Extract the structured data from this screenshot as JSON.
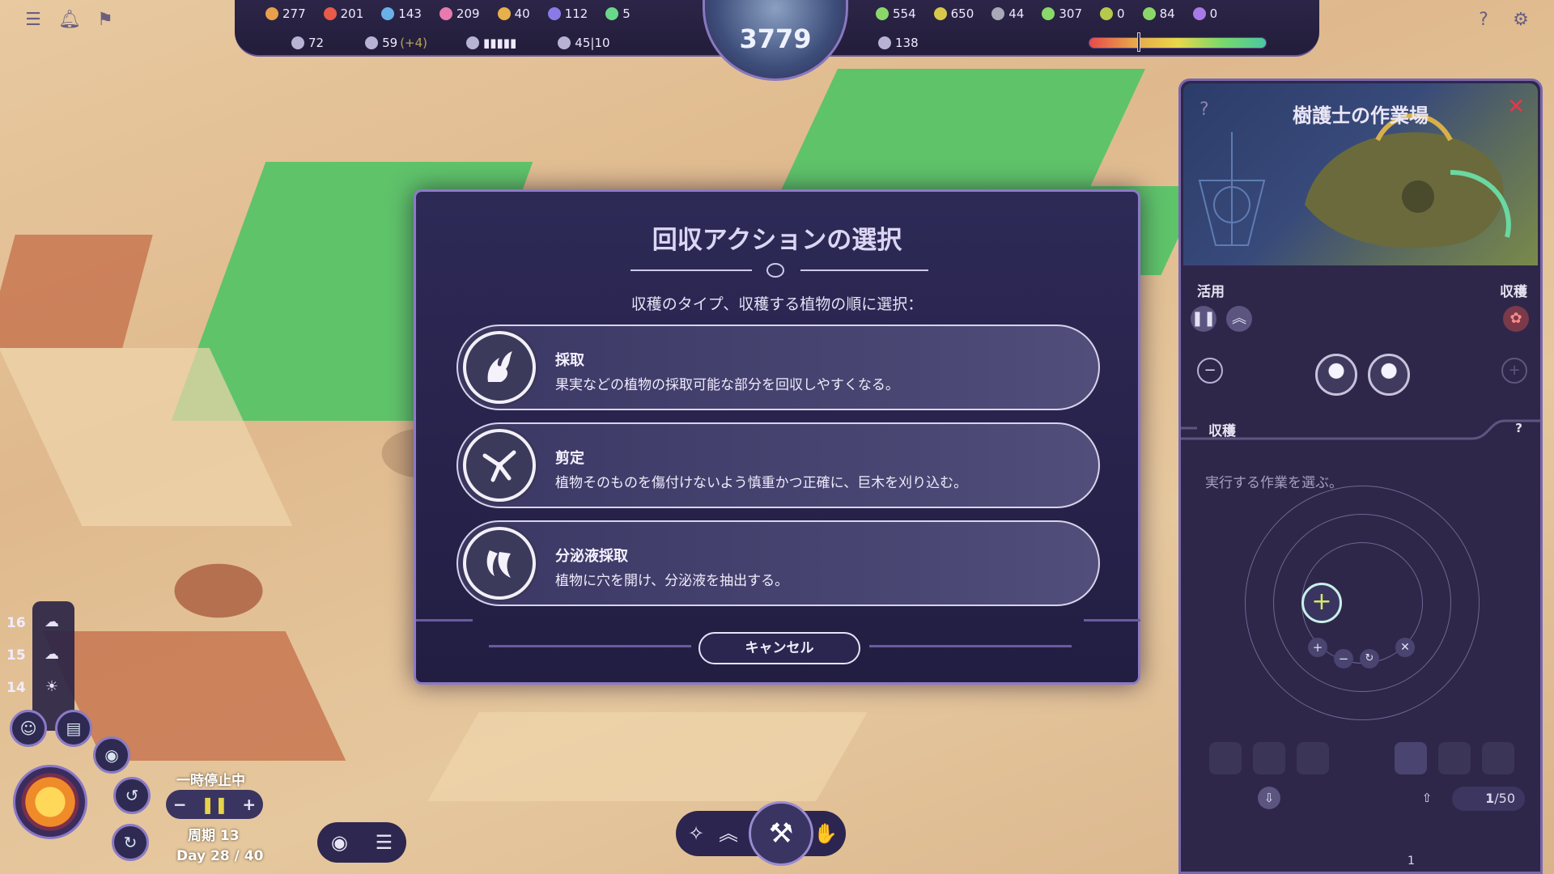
{
  "topbar": {
    "resources_row1": [
      {
        "icon": "food-icon",
        "value": "277",
        "color": "#e8a04a"
      },
      {
        "icon": "flame-icon",
        "value": "201",
        "color": "#e85a4a"
      },
      {
        "icon": "water-drop-icon",
        "value": "143",
        "color": "#6ab0e8"
      },
      {
        "icon": "fruit-icon",
        "value": "209",
        "color": "#e87ab0"
      },
      {
        "icon": "seed-icon",
        "value": "40",
        "color": "#e8b04a"
      },
      {
        "icon": "root-icon",
        "value": "112",
        "color": "#8a7ae8"
      },
      {
        "icon": "leaf-icon",
        "value": "5",
        "color": "#6ad88a"
      }
    ],
    "resources_row1_right": [
      {
        "icon": "herb-icon",
        "value": "554",
        "color": "#8ad86a"
      },
      {
        "icon": "wood-icon",
        "value": "650",
        "color": "#d8c84a"
      },
      {
        "icon": "stone-icon",
        "value": "44",
        "color": "#a8a8b8"
      },
      {
        "icon": "sprout-icon",
        "value": "307",
        "color": "#8ad86a"
      },
      {
        "icon": "pot-icon",
        "value": "0",
        "color": "#b8c84a"
      },
      {
        "icon": "flower-icon",
        "value": "84",
        "color": "#8ad86a"
      },
      {
        "icon": "scroll-icon",
        "value": "0",
        "color": "#a87ae8"
      }
    ],
    "stats_row2": [
      {
        "icon": "population-icon",
        "value": "72",
        "extra": ""
      },
      {
        "icon": "workers-icon",
        "value": "59",
        "extra": "(+4)"
      },
      {
        "icon": "heart-icon",
        "value": "▮▮▮▮▮",
        "extra": ""
      },
      {
        "icon": "housing-icon",
        "value": "45|10",
        "extra": ""
      }
    ],
    "stats_row2_right": [
      {
        "icon": "research-icon",
        "value": "138"
      }
    ],
    "center_value": "3779",
    "health_level": 0.28
  },
  "modal": {
    "title": "回収アクションの選択",
    "subtitle": "収穫のタイプ、収穫する植物の順に選択：",
    "options": [
      {
        "icon": "gather-hand-icon",
        "title": "採取",
        "desc": "果実などの植物の採取可能な部分を回収しやすくなる。"
      },
      {
        "icon": "prune-shears-icon",
        "title": "剪定",
        "desc": "植物そのものを傷付けないよう慎重かつ正確に、巨木を刈り込む。"
      },
      {
        "icon": "sap-tap-icon",
        "title": "分泌液採取",
        "desc": "植物に穴を開け、分泌液を抽出する。"
      }
    ],
    "cancel_label": "キャンセル"
  },
  "panel": {
    "title": "樹護士の作業場",
    "help": "?",
    "close": "✕",
    "use_label": "活用",
    "harvest_label": "収穫",
    "section_title": "収穫",
    "section_help": "?",
    "hint": "実行する作業を選ぶ。",
    "inventory_count": "1",
    "inventory_max": "/50",
    "slot_count": "1"
  },
  "hud": {
    "temps": [
      "16",
      "15",
      "14"
    ],
    "paused_label": "一時停止中",
    "cycle_label": "周期 13",
    "day_label": "Day 28 / 40"
  }
}
